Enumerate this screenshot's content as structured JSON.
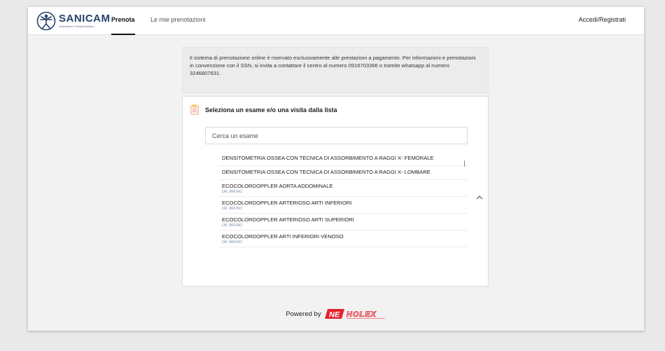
{
  "header": {
    "logo_name": "SANICAM",
    "logo_subtitle": "Ambulatorio Polispecialistico",
    "tabs": [
      {
        "label": "Prenota",
        "active": true
      },
      {
        "label": "Le mie prenotazioni",
        "active": false
      }
    ],
    "login_label": "Accedi/Registrati"
  },
  "notice": {
    "text": "Il sistema di prenotazione online è riservato esclusivamente alle prestazioni a pagamento. Per informazioni e prenotazioni in convenzione con il SSN, si invita a contattare il centro al numero 0916703366 o tramite whatsapp al numero 3246807631."
  },
  "selector": {
    "title": "Seleziona un esame e/o una visita dalla lista",
    "search_placeholder": "Cerca un esame",
    "items": [
      {
        "name": "DENSITOMETRIA OSSEA CON TECNICA DI ASSORBIMENTO A RAGGI X- FEMORALE",
        "doctor": ""
      },
      {
        "name": "DENSITOMETRIA OSSEA CON TECNICA DI ASSORBIMENTO A RAGGI X- LOMBARE",
        "doctor": ""
      },
      {
        "name": "ECOCOLORDOPPLER AORTA ADDOMINALE",
        "doctor": "DR. BRUNO"
      },
      {
        "name": "ECOCOLORDOPPLER ARTERIOSO ARTI INFERIORI",
        "doctor": "DR. BRUNO"
      },
      {
        "name": "ECOCOLORDOPPLER ARTERIOSO ARTI SUPERIORI",
        "doctor": "DR. BRUNO"
      },
      {
        "name": "ECOCOLORDOPPLER ARTI INFERIORI VENOSO",
        "doctor": "DR. BRUNO"
      }
    ]
  },
  "footer": {
    "powered_by": "Powered by",
    "brand_short": "NE",
    "brand_name": "HOLEX"
  },
  "colors": {
    "brand_navy": "#27426b",
    "brand_red": "#e4202c",
    "doctor_text": "#7d8da8",
    "page_bg": "#f2f2f2"
  },
  "icons": {
    "logo": "vitruvian-man-icon",
    "card": "clipboard-icon",
    "collapse": "chevron-up-icon"
  }
}
